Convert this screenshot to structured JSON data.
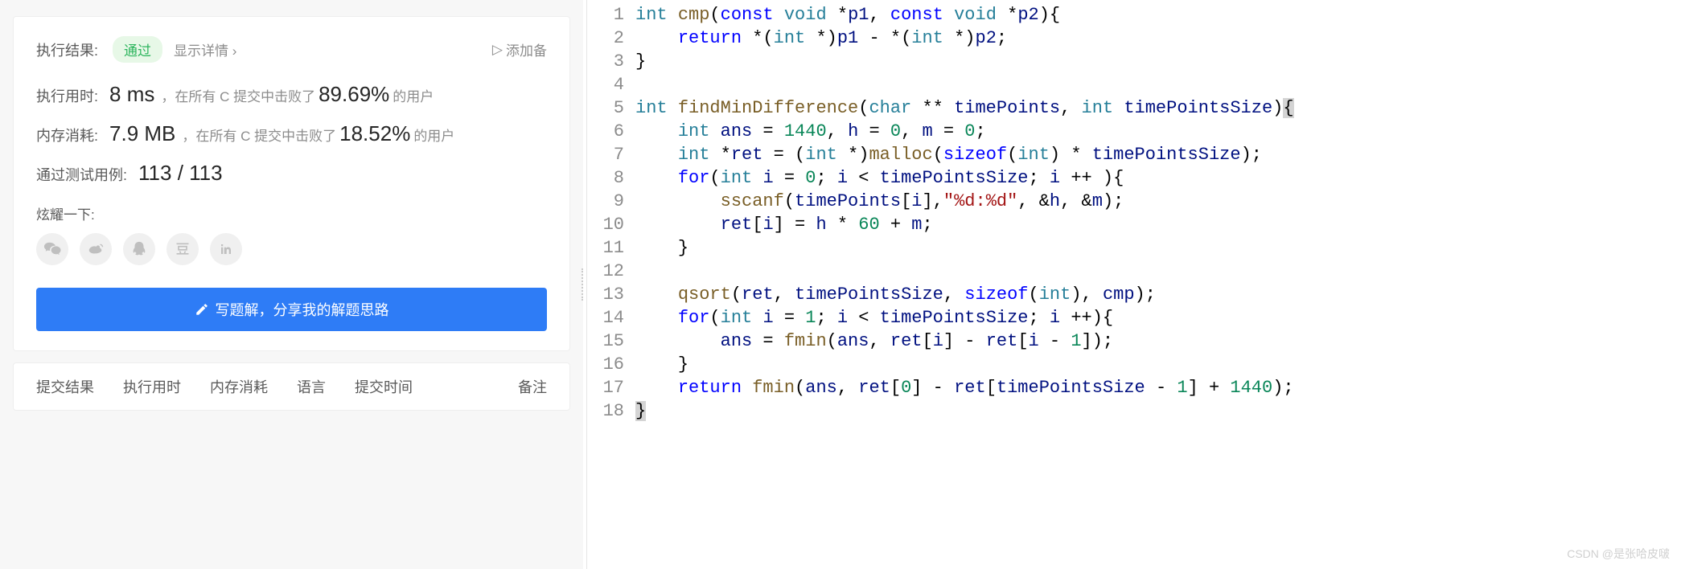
{
  "result": {
    "label": "执行结果:",
    "status": "通过",
    "details_link": "显示详情 ›",
    "add_note": "添加备",
    "runtime_label": "执行用时:",
    "runtime_value": "8 ms",
    "runtime_suffix1": "，在所有 C 提交中击败了",
    "runtime_percent": "89.69%",
    "runtime_suffix2": "的用户",
    "memory_label": "内存消耗:",
    "memory_value": "7.9 MB",
    "memory_suffix1": "，在所有 C 提交中击败了",
    "memory_percent": "18.52%",
    "memory_suffix2": "的用户",
    "testcases_label": "通过测试用例:",
    "testcases_value": "113 / 113",
    "share_label": "炫耀一下:",
    "write_solution": "写题解，分享我的解题思路"
  },
  "table_headers": [
    "提交结果",
    "执行用时",
    "内存消耗",
    "语言",
    "提交时间",
    "备注"
  ],
  "code": {
    "lines": [
      {
        "n": 1,
        "tokens": [
          [
            "t",
            "int"
          ],
          [
            "p",
            " "
          ],
          [
            "f",
            "cmp"
          ],
          [
            "p",
            "("
          ],
          [
            "k",
            "const"
          ],
          [
            "p",
            " "
          ],
          [
            "t",
            "void"
          ],
          [
            "p",
            " *"
          ],
          [
            "id",
            "p1"
          ],
          [
            "p",
            ", "
          ],
          [
            "k",
            "const"
          ],
          [
            "p",
            " "
          ],
          [
            "t",
            "void"
          ],
          [
            "p",
            " *"
          ],
          [
            "id",
            "p2"
          ],
          [
            "p",
            "){"
          ]
        ]
      },
      {
        "n": 2,
        "indent": 1,
        "tokens": [
          [
            "k",
            "return"
          ],
          [
            "p",
            " *("
          ],
          [
            "t",
            "int"
          ],
          [
            "p",
            " *)"
          ],
          [
            "id",
            "p1"
          ],
          [
            "p",
            " - *("
          ],
          [
            "t",
            "int"
          ],
          [
            "p",
            " *)"
          ],
          [
            "id",
            "p2"
          ],
          [
            "p",
            ";"
          ]
        ]
      },
      {
        "n": 3,
        "tokens": [
          [
            "p",
            "}"
          ]
        ]
      },
      {
        "n": 4,
        "tokens": []
      },
      {
        "n": 5,
        "tokens": [
          [
            "t",
            "int"
          ],
          [
            "p",
            " "
          ],
          [
            "f",
            "findMinDifference"
          ],
          [
            "p",
            "("
          ],
          [
            "t",
            "char"
          ],
          [
            "p",
            " ** "
          ],
          [
            "id",
            "timePoints"
          ],
          [
            "p",
            ", "
          ],
          [
            "t",
            "int"
          ],
          [
            "p",
            " "
          ],
          [
            "id",
            "timePointsSize"
          ],
          [
            "p",
            ")"
          ],
          [
            "hl",
            "{"
          ]
        ]
      },
      {
        "n": 6,
        "indent": 1,
        "tokens": [
          [
            "t",
            "int"
          ],
          [
            "p",
            " "
          ],
          [
            "id",
            "ans"
          ],
          [
            "p",
            " = "
          ],
          [
            "n",
            "1440"
          ],
          [
            "p",
            ", "
          ],
          [
            "id",
            "h"
          ],
          [
            "p",
            " = "
          ],
          [
            "n",
            "0"
          ],
          [
            "p",
            ", "
          ],
          [
            "id",
            "m"
          ],
          [
            "p",
            " = "
          ],
          [
            "n",
            "0"
          ],
          [
            "p",
            ";"
          ]
        ]
      },
      {
        "n": 7,
        "indent": 1,
        "tokens": [
          [
            "t",
            "int"
          ],
          [
            "p",
            " *"
          ],
          [
            "id",
            "ret"
          ],
          [
            "p",
            " = ("
          ],
          [
            "t",
            "int"
          ],
          [
            "p",
            " *)"
          ],
          [
            "f",
            "malloc"
          ],
          [
            "p",
            "("
          ],
          [
            "k",
            "sizeof"
          ],
          [
            "p",
            "("
          ],
          [
            "t",
            "int"
          ],
          [
            "p",
            ") * "
          ],
          [
            "id",
            "timePointsSize"
          ],
          [
            "p",
            ");"
          ]
        ]
      },
      {
        "n": 8,
        "indent": 1,
        "tokens": [
          [
            "k",
            "for"
          ],
          [
            "p",
            "("
          ],
          [
            "t",
            "int"
          ],
          [
            "p",
            " "
          ],
          [
            "id",
            "i"
          ],
          [
            "p",
            " = "
          ],
          [
            "n",
            "0"
          ],
          [
            "p",
            "; "
          ],
          [
            "id",
            "i"
          ],
          [
            "p",
            " < "
          ],
          [
            "id",
            "timePointsSize"
          ],
          [
            "p",
            "; "
          ],
          [
            "id",
            "i"
          ],
          [
            "p",
            " ++ ){"
          ]
        ]
      },
      {
        "n": 9,
        "indent": 2,
        "tokens": [
          [
            "f",
            "sscanf"
          ],
          [
            "p",
            "("
          ],
          [
            "id",
            "timePoints"
          ],
          [
            "p",
            "["
          ],
          [
            "id",
            "i"
          ],
          [
            "p",
            "],"
          ],
          [
            "s",
            "\"%d:%d\""
          ],
          [
            "p",
            ", &"
          ],
          [
            "id",
            "h"
          ],
          [
            "p",
            ", &"
          ],
          [
            "id",
            "m"
          ],
          [
            "p",
            ");"
          ]
        ]
      },
      {
        "n": 10,
        "indent": 2,
        "tokens": [
          [
            "id",
            "ret"
          ],
          [
            "p",
            "["
          ],
          [
            "id",
            "i"
          ],
          [
            "p",
            "] = "
          ],
          [
            "id",
            "h"
          ],
          [
            "p",
            " * "
          ],
          [
            "n",
            "60"
          ],
          [
            "p",
            " + "
          ],
          [
            "id",
            "m"
          ],
          [
            "p",
            ";"
          ]
        ]
      },
      {
        "n": 11,
        "indent": 1,
        "tokens": [
          [
            "p",
            "}"
          ]
        ]
      },
      {
        "n": 12,
        "tokens": []
      },
      {
        "n": 13,
        "indent": 1,
        "tokens": [
          [
            "f",
            "qsort"
          ],
          [
            "p",
            "("
          ],
          [
            "id",
            "ret"
          ],
          [
            "p",
            ", "
          ],
          [
            "id",
            "timePointsSize"
          ],
          [
            "p",
            ", "
          ],
          [
            "k",
            "sizeof"
          ],
          [
            "p",
            "("
          ],
          [
            "t",
            "int"
          ],
          [
            "p",
            "), "
          ],
          [
            "id",
            "cmp"
          ],
          [
            "p",
            ");"
          ]
        ]
      },
      {
        "n": 14,
        "indent": 1,
        "tokens": [
          [
            "k",
            "for"
          ],
          [
            "p",
            "("
          ],
          [
            "t",
            "int"
          ],
          [
            "p",
            " "
          ],
          [
            "id",
            "i"
          ],
          [
            "p",
            " = "
          ],
          [
            "n",
            "1"
          ],
          [
            "p",
            "; "
          ],
          [
            "id",
            "i"
          ],
          [
            "p",
            " < "
          ],
          [
            "id",
            "timePointsSize"
          ],
          [
            "p",
            "; "
          ],
          [
            "id",
            "i"
          ],
          [
            "p",
            " ++){"
          ]
        ]
      },
      {
        "n": 15,
        "indent": 2,
        "tokens": [
          [
            "id",
            "ans"
          ],
          [
            "p",
            " = "
          ],
          [
            "f",
            "fmin"
          ],
          [
            "p",
            "("
          ],
          [
            "id",
            "ans"
          ],
          [
            "p",
            ", "
          ],
          [
            "id",
            "ret"
          ],
          [
            "p",
            "["
          ],
          [
            "id",
            "i"
          ],
          [
            "p",
            "] - "
          ],
          [
            "id",
            "ret"
          ],
          [
            "p",
            "["
          ],
          [
            "id",
            "i"
          ],
          [
            "p",
            " - "
          ],
          [
            "n",
            "1"
          ],
          [
            "p",
            "]);"
          ]
        ]
      },
      {
        "n": 16,
        "indent": 1,
        "tokens": [
          [
            "p",
            "}"
          ]
        ]
      },
      {
        "n": 17,
        "indent": 1,
        "tokens": [
          [
            "k",
            "return"
          ],
          [
            "p",
            " "
          ],
          [
            "f",
            "fmin"
          ],
          [
            "p",
            "("
          ],
          [
            "id",
            "ans"
          ],
          [
            "p",
            ", "
          ],
          [
            "id",
            "ret"
          ],
          [
            "p",
            "["
          ],
          [
            "n",
            "0"
          ],
          [
            "p",
            "] - "
          ],
          [
            "id",
            "ret"
          ],
          [
            "p",
            "["
          ],
          [
            "id",
            "timePointsSize"
          ],
          [
            "p",
            " - "
          ],
          [
            "n",
            "1"
          ],
          [
            "p",
            "] + "
          ],
          [
            "n",
            "1440"
          ],
          [
            "p",
            ");"
          ]
        ]
      },
      {
        "n": 18,
        "tokens": [
          [
            "hl",
            "}"
          ]
        ]
      }
    ]
  },
  "watermark": "CSDN @是张哈皮啵"
}
